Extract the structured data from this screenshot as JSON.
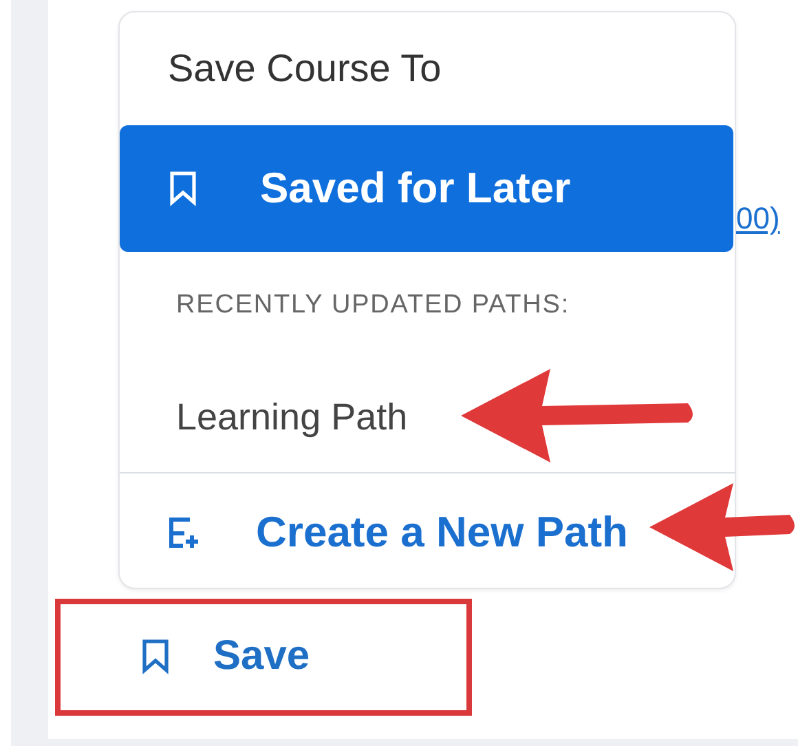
{
  "menu": {
    "title": "Save Course To",
    "options": [
      {
        "label": "Saved for Later",
        "selected": true,
        "kind": "bookmark"
      }
    ],
    "section_label": "RECENTLY UPDATED PATHS:",
    "paths": [
      {
        "label": "Learning Path",
        "selected": false
      }
    ],
    "create_action": "Create a New Path"
  },
  "background_link": "00)",
  "save_button": "Save",
  "annotations": [
    {
      "kind": "arrow"
    },
    {
      "kind": "arrow"
    },
    {
      "kind": "frame"
    }
  ]
}
